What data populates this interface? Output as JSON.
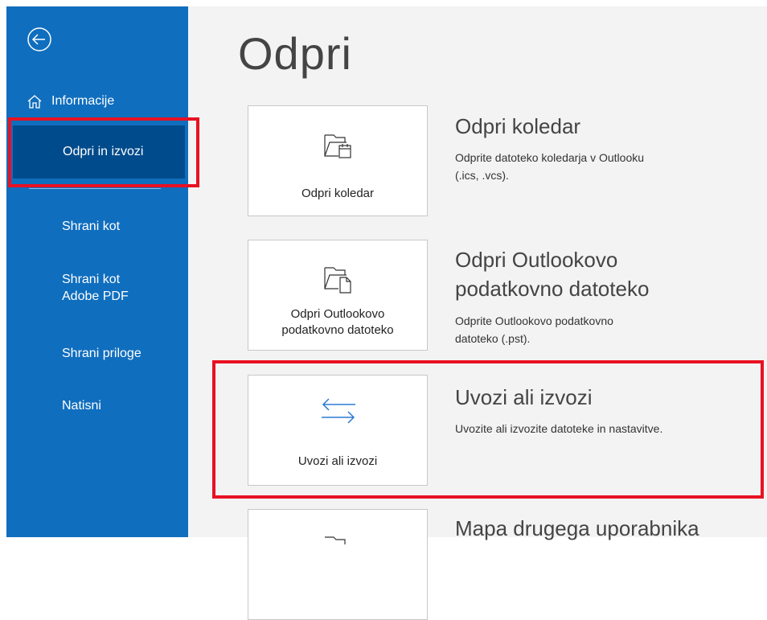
{
  "sidebar": {
    "back_icon": "back-arrow-circle-icon",
    "items": [
      {
        "label": "Informacije",
        "icon": "home-icon"
      },
      {
        "label": "Odpri in izvozi"
      },
      {
        "label": "Shrani kot"
      },
      {
        "label_line1": "Shrani kot",
        "label_line2": "Adobe PDF"
      },
      {
        "label": "Shrani priloge"
      },
      {
        "label": "Natisni"
      }
    ],
    "selected": "Odpri in izvozi",
    "background_color": "#106ebe",
    "selected_color": "#004b8c"
  },
  "main": {
    "title": "Odpri",
    "options": [
      {
        "tile_label": "Odpri koledar",
        "title": "Odpri koledar",
        "desc_line1": "Odprite datoteko koledarja v Outlooku",
        "desc_line2": "(.ics, .vcs).",
        "icon": "open-calendar-folder-icon"
      },
      {
        "tile_label_line1": "Odpri Outlookovo",
        "tile_label_line2": "podatkovno datoteko",
        "title_line1": "Odpri Outlookovo",
        "title_line2": "podatkovno datoteko",
        "desc_line1": "Odprite Outlookovo podatkovno",
        "desc_line2": "datoteko (.pst).",
        "icon": "open-data-file-folder-icon"
      },
      {
        "tile_label": "Uvozi ali izvozi",
        "title": "Uvozi ali izvozi",
        "desc": "Uvozite ali izvozite datoteke in nastavitve.",
        "icon": "import-export-arrows-icon"
      },
      {
        "title": "Mapa drugega uporabnika",
        "icon": "folder-icon"
      }
    ]
  },
  "highlight_color": "#e81123"
}
